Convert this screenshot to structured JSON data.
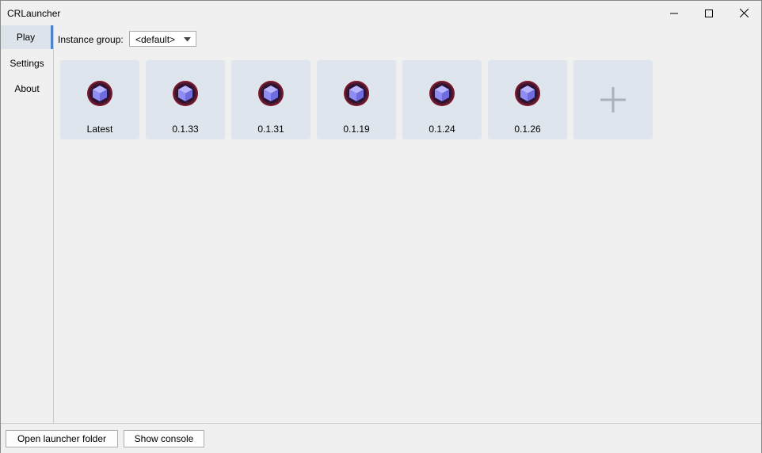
{
  "window": {
    "title": "CRLauncher",
    "controls": [
      "minimize-icon",
      "maximize-icon",
      "close-icon"
    ]
  },
  "sidebar": {
    "items": [
      {
        "label": "Play",
        "active": true
      },
      {
        "label": "Settings",
        "active": false
      },
      {
        "label": "About",
        "active": false
      }
    ]
  },
  "toolbar": {
    "instance_group_label": "Instance group:",
    "instance_group_value": "<default>"
  },
  "instances": [
    {
      "label": "Latest",
      "icon": "cube-logo-icon"
    },
    {
      "label": "0.1.33",
      "icon": "cube-logo-icon"
    },
    {
      "label": "0.1.31",
      "icon": "cube-logo-icon"
    },
    {
      "label": "0.1.19",
      "icon": "cube-logo-icon"
    },
    {
      "label": "0.1.24",
      "icon": "cube-logo-icon"
    },
    {
      "label": "0.1.26",
      "icon": "cube-logo-icon"
    }
  ],
  "add_instance": {
    "icon": "plus-icon"
  },
  "footer": {
    "open_folder_label": "Open launcher folder",
    "show_console_label": "Show console"
  },
  "colors": {
    "active_accent": "#4a86c8",
    "tile_background": "#dfe5ec",
    "icon_ring": "#8a1a2c",
    "icon_cube": "#8f8cf5"
  }
}
